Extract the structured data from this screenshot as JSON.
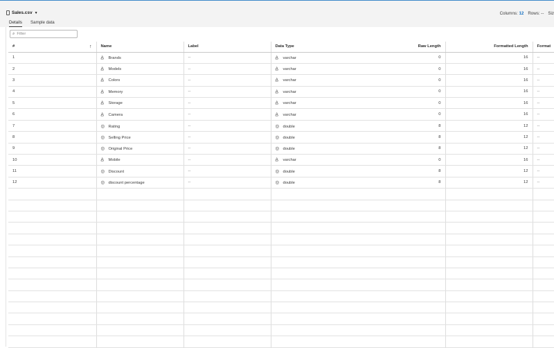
{
  "header": {
    "file_name": "Sales.csv",
    "columns_label": "Columns:",
    "columns_value": "12",
    "rows_label": "Rows:",
    "rows_value": "--",
    "size_label": "Siz"
  },
  "tabs": [
    {
      "label": "Details",
      "active": true
    },
    {
      "label": "Sample data",
      "active": false
    }
  ],
  "filter": {
    "placeholder": "Filter"
  },
  "table": {
    "headers": {
      "num": "#",
      "name": "Name",
      "label": "Label",
      "type": "Data Type",
      "raw": "Raw Length",
      "fmt_len": "Formatted Length",
      "format": "Format"
    },
    "rows": [
      {
        "num": "1",
        "name": "Brands",
        "label": "--",
        "type": "varchar",
        "raw": "0",
        "fmt_len": "16",
        "format": "--"
      },
      {
        "num": "2",
        "name": "Models",
        "label": "--",
        "type": "varchar",
        "raw": "0",
        "fmt_len": "16",
        "format": "--"
      },
      {
        "num": "3",
        "name": "Colors",
        "label": "--",
        "type": "varchar",
        "raw": "0",
        "fmt_len": "16",
        "format": "--"
      },
      {
        "num": "4",
        "name": "Memory",
        "label": "--",
        "type": "varchar",
        "raw": "0",
        "fmt_len": "16",
        "format": "--"
      },
      {
        "num": "5",
        "name": "Storage",
        "label": "--",
        "type": "varchar",
        "raw": "0",
        "fmt_len": "16",
        "format": "--"
      },
      {
        "num": "6",
        "name": "Camera",
        "label": "--",
        "type": "varchar",
        "raw": "0",
        "fmt_len": "16",
        "format": "--"
      },
      {
        "num": "7",
        "name": "Rating",
        "label": "--",
        "type": "double",
        "raw": "8",
        "fmt_len": "12",
        "format": "--"
      },
      {
        "num": "8",
        "name": "Selling Price",
        "label": "--",
        "type": "double",
        "raw": "8",
        "fmt_len": "12",
        "format": "--"
      },
      {
        "num": "9",
        "name": "Original Price",
        "label": "--",
        "type": "double",
        "raw": "8",
        "fmt_len": "12",
        "format": "--"
      },
      {
        "num": "10",
        "name": "Mobile",
        "label": "--",
        "type": "varchar",
        "raw": "0",
        "fmt_len": "16",
        "format": "--"
      },
      {
        "num": "11",
        "name": "Discount",
        "label": "--",
        "type": "double",
        "raw": "8",
        "fmt_len": "12",
        "format": "--"
      },
      {
        "num": "12",
        "name": "discount percentage",
        "label": "--",
        "type": "double",
        "raw": "8",
        "fmt_len": "12",
        "format": "--"
      }
    ]
  },
  "icons": {
    "varchar": "character-type-icon",
    "double": "numeric-type-icon",
    "filter": "search-icon",
    "sort": "sort-ascending-icon",
    "file": "file-icon"
  },
  "colors": {
    "accent": "#1570c2",
    "top_bar": "#3a87c8"
  }
}
